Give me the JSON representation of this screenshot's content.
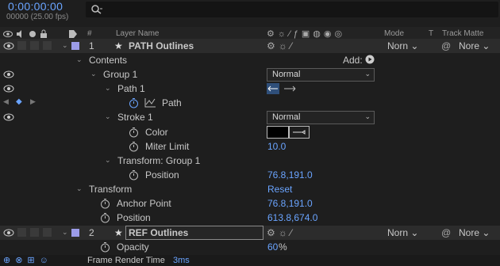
{
  "timecode": "0:00:00:00",
  "fps": "00000 (25.00 fps)",
  "columns": {
    "hash": "#",
    "layer_name": "Layer Name",
    "mode": "Mode",
    "t": "T",
    "track_matte": "Track Matte"
  },
  "layer1": {
    "number": "1",
    "name": "PATH Outlines",
    "mode": "Norn",
    "matte": "Nore"
  },
  "contents": {
    "label": "Contents",
    "add_label": "Add:"
  },
  "group1": {
    "label": "Group 1",
    "blend": "Normal"
  },
  "path1": {
    "label": "Path 1",
    "path": "Path"
  },
  "stroke1": {
    "label": "Stroke 1",
    "blend": "Normal",
    "color_label": "Color",
    "color_value": "#000000",
    "miter_label": "Miter Limit",
    "miter_value": "10.0"
  },
  "transform_group": {
    "label": "Transform: Group 1",
    "position_label": "Position",
    "position_value": "76.8,191.0"
  },
  "transform": {
    "label": "Transform",
    "reset": "Reset",
    "anchor_label": "Anchor Point",
    "anchor_value": "76.8,191.0",
    "position_label": "Position",
    "position_value": "613.8,674.0"
  },
  "layer2": {
    "number": "2",
    "name": "REF Outlines",
    "mode": "Norn",
    "matte": "Nore"
  },
  "opacity": {
    "label": "Opacity",
    "value": "60",
    "unit": "%"
  },
  "footer": {
    "render_label": "Frame Render Time",
    "render_value": "3ms"
  },
  "colors": {
    "accent": "#6aa4ff",
    "label_swatch": "#9b9be8"
  }
}
